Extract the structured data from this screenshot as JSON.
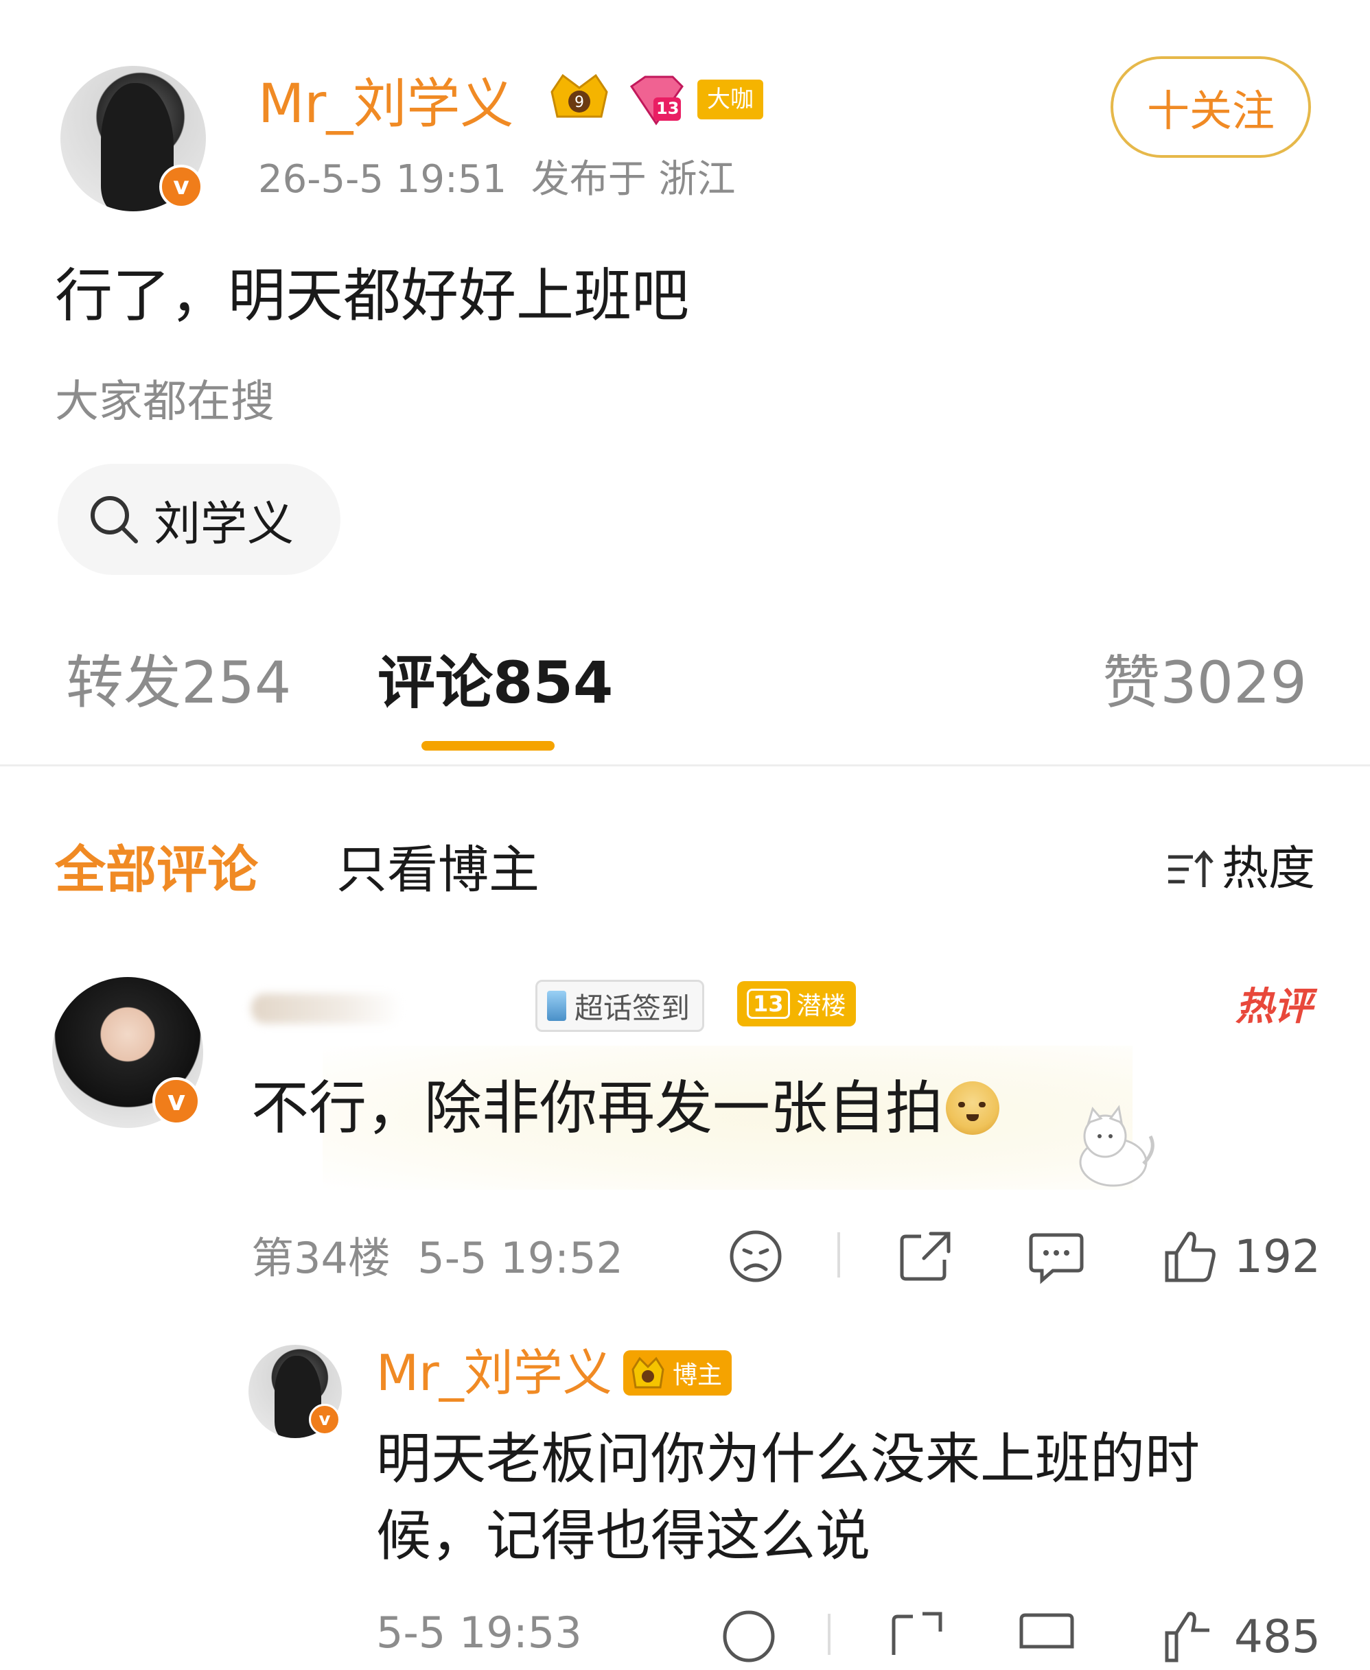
{
  "post": {
    "author": "Mr_刘学义",
    "level_badge": "13",
    "big_badge": "大咖",
    "follow_label": "十关注",
    "meta": "26-5-5 19:51  发布于 浙江",
    "content": "行了，明天都好好上班吧",
    "search_section_title": "大家都在搜",
    "search_chip": "刘学义"
  },
  "tabs": {
    "repost": "转发254",
    "comment": "评论854",
    "like": "赞3029"
  },
  "filter": {
    "all": "全部评论",
    "only_author": "只看博主",
    "sort": "热度"
  },
  "comment": {
    "badge_supertopic": "超话签到",
    "badge_level": "13",
    "badge_level_label": "潜楼",
    "hot_tag": "热评",
    "text": "不行，除非你再发一张自拍",
    "meta": "第34楼  5-5 19:52",
    "likes": "192"
  },
  "reply": {
    "author": "Mr_刘学义",
    "author_tag": "博主",
    "text_line1": "明天老板问你为什么没来上班的时",
    "text_line2": "候，记得也得这么说",
    "meta": "5-5 19:53",
    "likes": "485"
  },
  "colors": {
    "accent": "#f08a24",
    "gold": "#f5b400",
    "hot": "#e8483b"
  }
}
